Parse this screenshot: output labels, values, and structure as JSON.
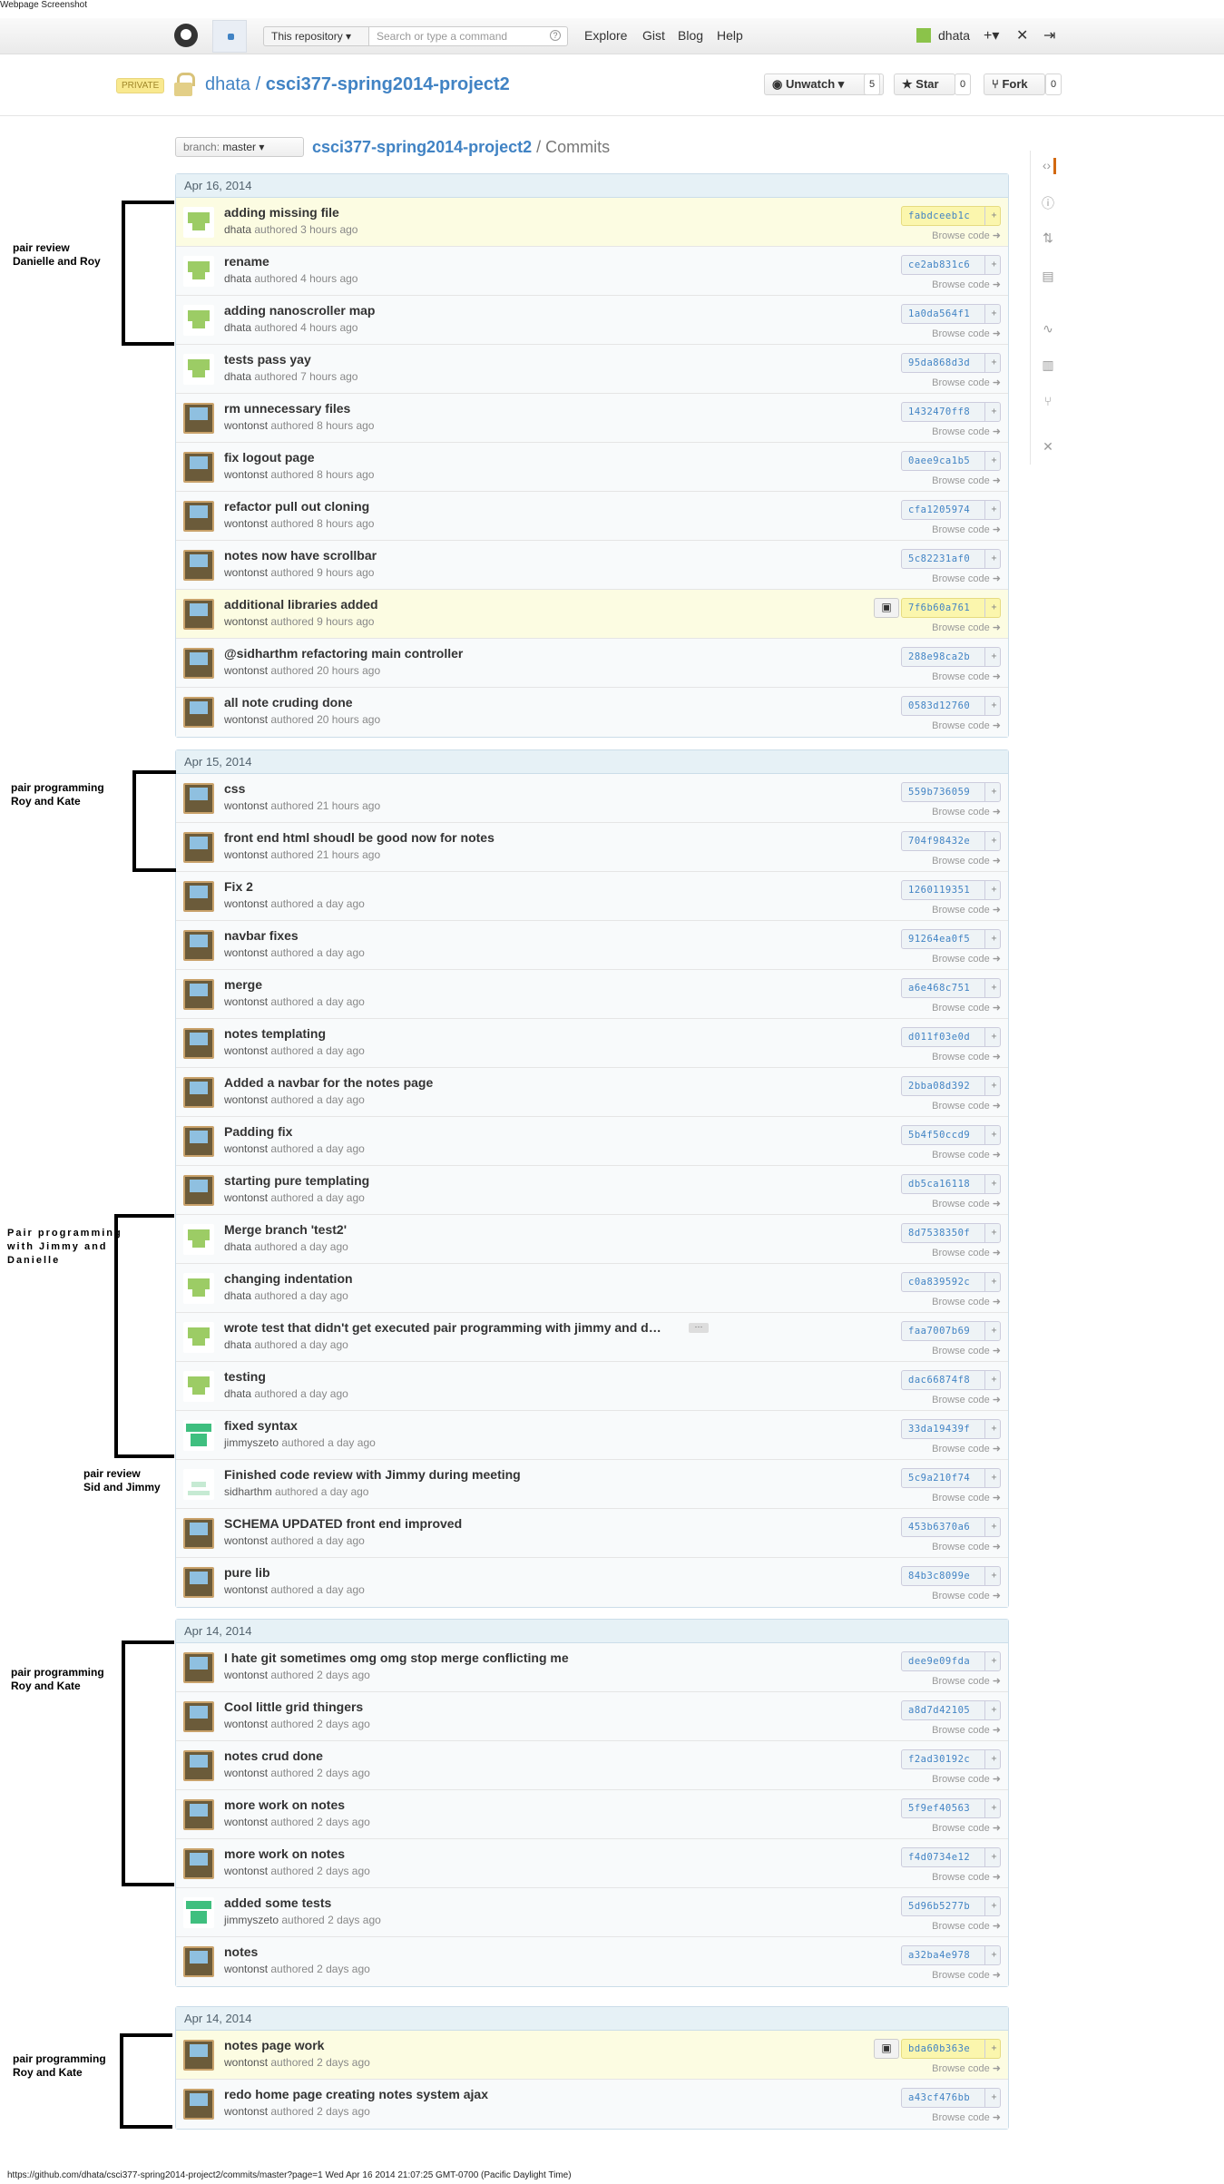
{
  "caption": "Webpage Screenshot",
  "footer_caption": "https://github.com/dhata/csci377-spring2014-project2/commits/master?page=1 Wed Apr 16 2014 21:07:25 GMT-0700 (Pacific Daylight Time)",
  "header": {
    "scope": "This repository",
    "search_placeholder": "Search or type a command",
    "nav": [
      "Explore",
      "Gist",
      "Blog",
      "Help"
    ],
    "user": "dhata",
    "plus": "+",
    "search_help": "?"
  },
  "repo": {
    "private_label": "PRIVATE",
    "owner": "dhata",
    "sep": "/",
    "name": "csci377-spring2014-project2",
    "unwatch_label": "Unwatch",
    "unwatch_count": "5",
    "star_label": "Star",
    "star_count": "0",
    "fork_label": "Fork",
    "fork_count": "0"
  },
  "branch": {
    "prefix": "branch:",
    "name": "master"
  },
  "crumb": {
    "repo": "csci377-spring2014-project2",
    "page": "/ Commits"
  },
  "browse_label": "Browse code",
  "authored": "authored",
  "groups": [
    {
      "date": "Apr 16, 2014",
      "commits": [
        {
          "msg": "adding missing file",
          "author": "dhata",
          "time": "3 hours ago",
          "sha": "fabdceeb1c",
          "av": "dhata",
          "hl": true
        },
        {
          "msg": "rename",
          "author": "dhata",
          "time": "4 hours ago",
          "sha": "ce2ab831c6",
          "av": "dhata"
        },
        {
          "msg": "adding nanoscroller map",
          "author": "dhata",
          "time": "4 hours ago",
          "sha": "1a0da564f1",
          "av": "dhata"
        },
        {
          "msg": "tests pass yay",
          "author": "dhata",
          "time": "7 hours ago",
          "sha": "95da868d3d",
          "av": "dhata"
        },
        {
          "msg": "rm unnecessary files",
          "author": "wontonst",
          "time": "8 hours ago",
          "sha": "1432470ff8",
          "av": "wontonst"
        },
        {
          "msg": "fix logout page",
          "author": "wontonst",
          "time": "8 hours ago",
          "sha": "0aee9ca1b5",
          "av": "wontonst"
        },
        {
          "msg": "refactor pull out cloning",
          "author": "wontonst",
          "time": "8 hours ago",
          "sha": "cfa1205974",
          "av": "wontonst"
        },
        {
          "msg": "notes now have scrollbar",
          "author": "wontonst",
          "time": "9 hours ago",
          "sha": "5c82231af0",
          "av": "wontonst"
        },
        {
          "msg": "additional libraries added",
          "author": "wontonst",
          "time": "9 hours ago",
          "sha": "7f6b60a761",
          "av": "wontonst",
          "hl": true,
          "clip": true
        },
        {
          "msg": "@sidharthm refactoring main controller",
          "author": "wontonst",
          "time": "20 hours ago",
          "sha": "288e98ca2b",
          "av": "wontonst"
        },
        {
          "msg": "all note cruding done",
          "author": "wontonst",
          "time": "20 hours ago",
          "sha": "0583d12760",
          "av": "wontonst"
        }
      ]
    },
    {
      "date": "Apr 15, 2014",
      "commits": [
        {
          "msg": "css",
          "author": "wontonst",
          "time": "21 hours ago",
          "sha": "559b736059",
          "av": "wontonst"
        },
        {
          "msg": "front end html shoudl be good now for notes",
          "author": "wontonst",
          "time": "21 hours ago",
          "sha": "704f98432e",
          "av": "wontonst"
        },
        {
          "msg": "Fix 2",
          "author": "wontonst",
          "time": "a day ago",
          "sha": "1260119351",
          "av": "wontonst"
        },
        {
          "msg": "navbar fixes",
          "author": "wontonst",
          "time": "a day ago",
          "sha": "91264ea0f5",
          "av": "wontonst"
        },
        {
          "msg": "merge",
          "author": "wontonst",
          "time": "a day ago",
          "sha": "a6e468c751",
          "av": "wontonst"
        },
        {
          "msg": "notes templating",
          "author": "wontonst",
          "time": "a day ago",
          "sha": "d011f03e0d",
          "av": "wontonst"
        },
        {
          "msg": "Added a navbar for the notes page",
          "author": "wontonst",
          "time": "a day ago",
          "sha": "2bba08d392",
          "av": "wontonst"
        },
        {
          "msg": "Padding fix",
          "author": "wontonst",
          "time": "a day ago",
          "sha": "5b4f50ccd9",
          "av": "wontonst"
        },
        {
          "msg": "starting pure templating",
          "author": "wontonst",
          "time": "a day ago",
          "sha": "db5ca16118",
          "av": "wontonst"
        },
        {
          "msg": "Merge branch 'test2'",
          "author": "dhata",
          "time": "a day ago",
          "sha": "8d7538350f",
          "av": "dhata"
        },
        {
          "msg": "changing indentation",
          "author": "dhata",
          "time": "a day ago",
          "sha": "c0a839592c",
          "av": "dhata"
        },
        {
          "msg": "wrote test that didn't get executed pair programming with jimmy and d…",
          "author": "dhata",
          "time": "a day ago",
          "sha": "faa7007b69",
          "av": "dhata",
          "ell": "···"
        },
        {
          "msg": "testing",
          "author": "dhata",
          "time": "a day ago",
          "sha": "dac66874f8",
          "av": "dhata"
        },
        {
          "msg": "fixed syntax",
          "author": "jimmyszeto",
          "time": "a day ago",
          "sha": "33da19439f",
          "av": "jimmy"
        },
        {
          "msg": "Finished code review with Jimmy during meeting",
          "author": "sidharthm",
          "time": "a day ago",
          "sha": "5c9a210f74",
          "av": "sid"
        },
        {
          "msg": "SCHEMA UPDATED front end improved",
          "author": "wontonst",
          "time": "a day ago",
          "sha": "453b6370a6",
          "av": "wontonst"
        },
        {
          "msg": "pure lib",
          "author": "wontonst",
          "time": "a day ago",
          "sha": "84b3c8099e",
          "av": "wontonst"
        }
      ]
    },
    {
      "date": "Apr 14, 2014",
      "commits": [
        {
          "msg": "I hate git sometimes omg omg stop merge conflicting me",
          "author": "wontonst",
          "time": "2 days ago",
          "sha": "dee9e09fda",
          "av": "wontonst"
        },
        {
          "msg": "Cool little grid thingers",
          "author": "wontonst",
          "time": "2 days ago",
          "sha": "a8d7d42105",
          "av": "wontonst"
        },
        {
          "msg": "notes crud done",
          "author": "wontonst",
          "time": "2 days ago",
          "sha": "f2ad30192c",
          "av": "wontonst"
        },
        {
          "msg": "more work on notes",
          "author": "wontonst",
          "time": "2 days ago",
          "sha": "5f9ef40563",
          "av": "wontonst"
        },
        {
          "msg": "more work on notes",
          "author": "wontonst",
          "time": "2 days ago",
          "sha": "f4d0734e12",
          "av": "wontonst"
        },
        {
          "msg": "added some tests",
          "author": "jimmyszeto",
          "time": "2 days ago",
          "sha": "5d96b5277b",
          "av": "jimmy"
        },
        {
          "msg": "notes",
          "author": "wontonst",
          "time": "2 days ago",
          "sha": "a32ba4e978",
          "av": "wontonst"
        }
      ]
    },
    {
      "date": "Apr 14, 2014",
      "commits": [
        {
          "msg": "notes page work",
          "author": "wontonst",
          "time": "2 days ago",
          "sha": "bda60b363e",
          "av": "wontonst",
          "hl": true,
          "clip": true
        },
        {
          "msg": "redo home page creating notes system ajax",
          "author": "wontonst",
          "time": "2 days ago",
          "sha": "a43cf476bb",
          "av": "wontonst"
        }
      ]
    }
  ],
  "annotations": [
    {
      "lines": [
        "pair review",
        "Danielle and Roy"
      ]
    },
    {
      "lines": [
        "pair programming",
        "Roy and Kate"
      ]
    },
    {
      "lines": [
        "Pair programming",
        "with Jimmy and",
        "Danielle"
      ]
    },
    {
      "lines": [
        "pair review",
        "Sid and Jimmy"
      ]
    },
    {
      "lines": [
        "pair programming",
        "Roy and Kate"
      ]
    },
    {
      "lines": [
        "pair programming",
        "Roy and Kate"
      ]
    }
  ],
  "icons": {
    "sidebar": [
      "code-icon",
      "issues-icon",
      "pull-requests-icon",
      "wiki-icon",
      "pulse-icon",
      "graphs-icon",
      "network-icon",
      "settings-icon"
    ],
    "browse": "arrow-right-icon",
    "clipboard": "clipboard-icon"
  }
}
